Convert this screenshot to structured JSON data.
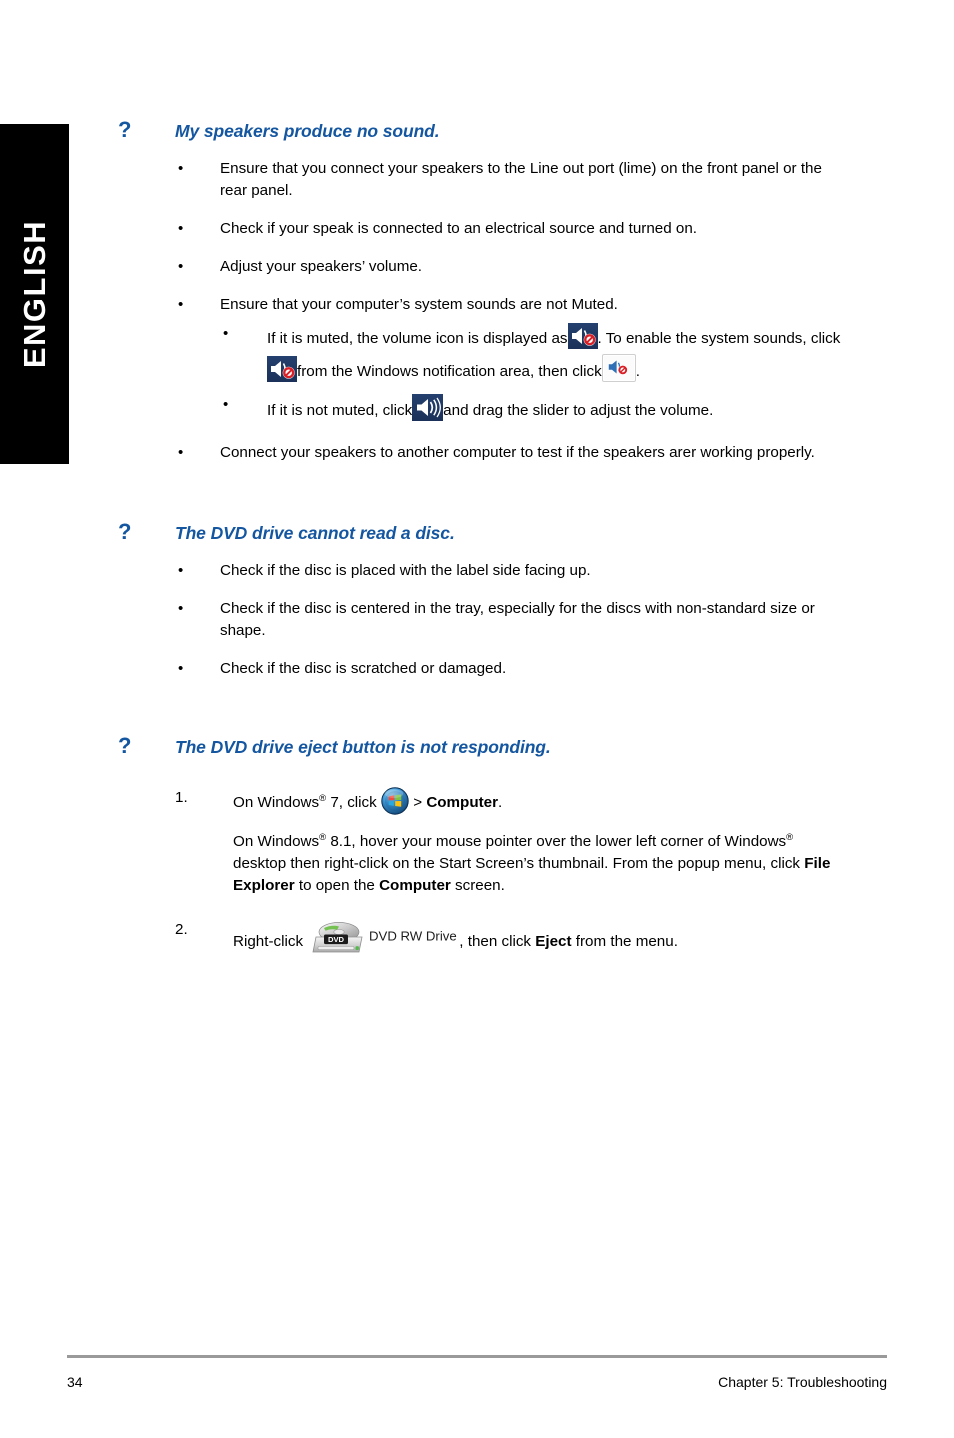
{
  "sidebar": {
    "language_tab": "ENGLISH"
  },
  "page": {
    "question_marker": "?"
  },
  "sections": [
    {
      "id": "speakers-no-sound",
      "heading": "My speakers produce no sound.",
      "bullets": [
        {
          "marker": "•",
          "text": "Ensure that you connect your speakers to the Line out port (lime) on the front panel or the rear panel."
        },
        {
          "marker": "•",
          "text": "Check if your speak is connected to an electrical source and turned on."
        },
        {
          "marker": "•",
          "text": "Adjust your speakers’ volume."
        },
        {
          "marker": "•",
          "text": "Ensure that your computer’s system sounds are not Muted.",
          "subbullets": [
            {
              "marker": "•",
              "part1": "If it is muted, the volume icon is displayed as",
              "icon1": "speaker-muted-dark-icon",
              "part2": ". To enable the system sounds, click",
              "icon2": "speaker-muted-dark-icon",
              "part3": "from the Windows notification area, then click",
              "icon3": "speaker-muted-light-icon",
              "part4": "."
            },
            {
              "marker": "•",
              "part1": "If it is not muted, click",
              "icon1": "speaker-volume-dark-icon",
              "part2": "and drag the slider to adjust the volume."
            }
          ]
        },
        {
          "marker": "•",
          "text": "Connect your speakers to another computer to test if the speakers arer working properly."
        }
      ]
    },
    {
      "id": "dvd-cannot-read",
      "heading": "The DVD drive cannot read a disc.",
      "bullets": [
        {
          "marker": "•",
          "text": "Check if the disc is placed with the label side facing up."
        },
        {
          "marker": "•",
          "text": "Check if the disc is centered in the tray, especially for the discs with non-standard size or shape."
        },
        {
          "marker": "•",
          "text": "Check if the disc is scratched or damaged."
        }
      ]
    },
    {
      "id": "dvd-eject-not-responding",
      "heading": "The DVD drive eject button is not responding.",
      "steps": [
        {
          "marker": "1.",
          "line1_part1": "On Windows",
          "line1_sup": "®",
          "line1_part2": " 7, click",
          "line1_icon": "windows-start-orb-icon",
          "line1_part3": ">",
          "line1_bold": "Computer",
          "line1_part4": ".",
          "paragraph_part1": "On Windows",
          "paragraph_sup1": "®",
          "paragraph_part2": " 8.1, hover your mouse pointer over the lower left corner of Windows",
          "paragraph_sup2": "®",
          "paragraph_part3": " desktop then right-click on the Start Screen’s thumbnail. From the popup menu, click ",
          "paragraph_bold1": "File Explorer",
          "paragraph_part4": " to open the ",
          "paragraph_bold2": "Computer",
          "paragraph_part5": " screen."
        },
        {
          "marker": "2.",
          "line1_part1": "Right-click",
          "line1_icon": "dvd-rw-drive-icon",
          "icon_label": "DVD RW Drive",
          "line1_part2": ", then click ",
          "line1_bold": "Eject",
          "line1_part3": " from the menu."
        }
      ]
    }
  ],
  "footer": {
    "page_number": "34",
    "chapter": "Chapter 5: Troubleshooting"
  },
  "colors": {
    "heading_blue": "#1456A0",
    "tab_background": "#000000",
    "tab_text": "#FFFFFF",
    "icon_chip_dark": "#1F3864",
    "footer_rule": "#9A9A9A"
  }
}
